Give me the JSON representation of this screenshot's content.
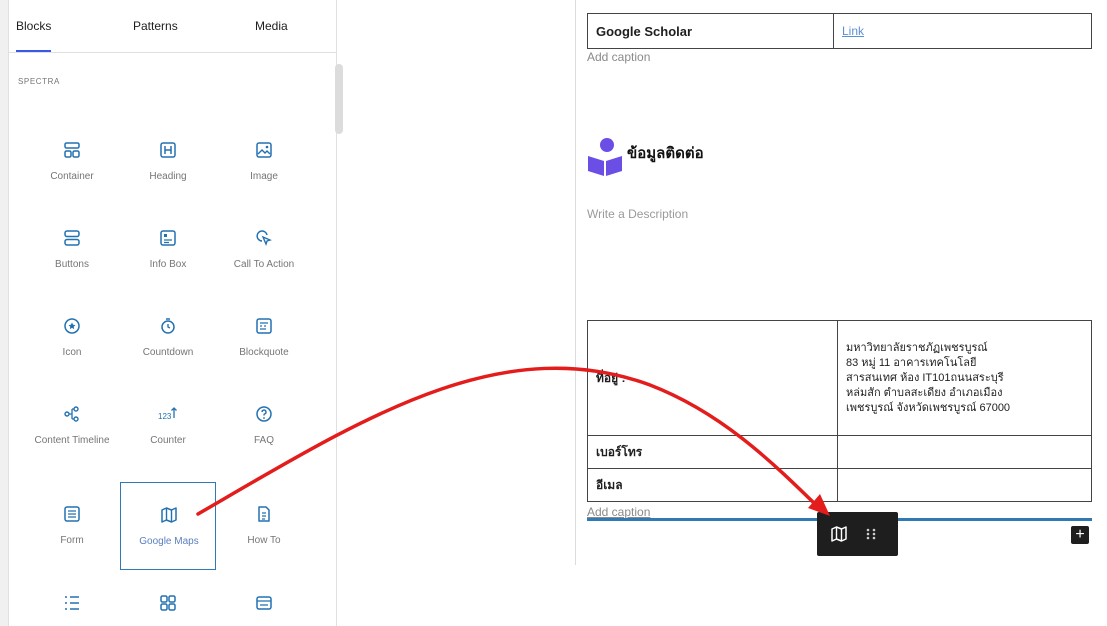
{
  "inserter": {
    "tabs": [
      "Blocks",
      "Patterns",
      "Media"
    ],
    "category": "SPECTRA",
    "blocks": [
      {
        "label": "Container",
        "icon": "container-icon"
      },
      {
        "label": "Heading",
        "icon": "heading-icon"
      },
      {
        "label": "Image",
        "icon": "image-icon"
      },
      {
        "label": "Buttons",
        "icon": "buttons-icon"
      },
      {
        "label": "Info Box",
        "icon": "info-box-icon"
      },
      {
        "label": "Call To Action",
        "icon": "call-to-action-icon"
      },
      {
        "label": "Icon",
        "icon": "star-icon"
      },
      {
        "label": "Countdown",
        "icon": "countdown-icon"
      },
      {
        "label": "Blockquote",
        "icon": "blockquote-icon"
      },
      {
        "label": "Content Timeline",
        "icon": "timeline-icon"
      },
      {
        "label": "Counter",
        "icon": "counter-icon"
      },
      {
        "label": "FAQ",
        "icon": "faq-icon"
      },
      {
        "label": "Form",
        "icon": "form-icon"
      },
      {
        "label": "Google Maps",
        "icon": "map-icon"
      },
      {
        "label": "How To",
        "icon": "how-to-icon"
      }
    ],
    "counter_glyph": "123"
  },
  "editor": {
    "top_table": {
      "label": "Google Scholar",
      "link": "Link"
    },
    "caption_top": "Add caption",
    "contact_heading": "ข้อมูลติดต่อ",
    "description_placeholder": "Write a Description",
    "info_table": [
      {
        "label": "ที่อยู่ :",
        "value": "มหาวิทยาลัยราชภัฏเพชรบูรณ์\n83 หมู่ 11 อาคารเทคโนโลยี\nสารสนเทศ ห้อง IT101ถนนสระบุรี\nหล่มสัก ตำบลสะเดียง อำเภอเมือง\nเพชรบูรณ์ จังหวัดเพชรบูรณ์ 67000"
      },
      {
        "label": "เบอร์โทร",
        "value": ""
      },
      {
        "label": "อีเมล",
        "value": ""
      }
    ],
    "caption_bottom": "Add caption",
    "plus_label": "+"
  },
  "colors": {
    "accent": "#2f7ab5",
    "arrow": "#e31c1c",
    "icon_purple": "#6b4ee6"
  }
}
